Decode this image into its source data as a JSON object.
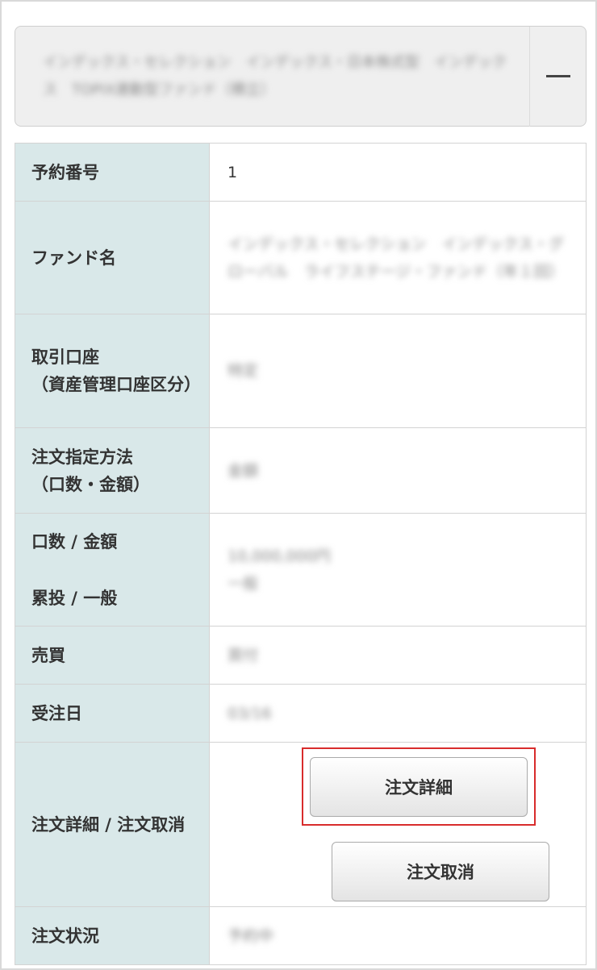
{
  "accordion": {
    "title": "インデックス・セレクション　インデックス・日本株式型　インデックス　TOPIX連動型ファンド（積立）",
    "toggle_symbol": "−"
  },
  "rows": [
    {
      "label": "予約番号",
      "value": "1"
    },
    {
      "label": "ファンド名",
      "value": "インデックス・セレクション　インデックス・グローバル　ライフステージ・ファンド（年１回）"
    },
    {
      "label": "取引口座\n（資産管理口座区分）",
      "value": "特定"
    },
    {
      "label": "注文指定方法\n（口数・金額）",
      "value": "金額"
    },
    {
      "label_line1": "口数 / 金額",
      "label_line2": "累投 / 一般",
      "value_line1": "10,000,000円",
      "value_line2": "一般"
    },
    {
      "label": "売買",
      "value": "買付"
    },
    {
      "label": "受注日",
      "value": "03/16"
    },
    {
      "label": "注文詳細 / 注文取消",
      "buttons": {
        "detail": "注文詳細",
        "cancel": "注文取消"
      }
    },
    {
      "label": "注文状況",
      "value": "予約中"
    }
  ]
}
